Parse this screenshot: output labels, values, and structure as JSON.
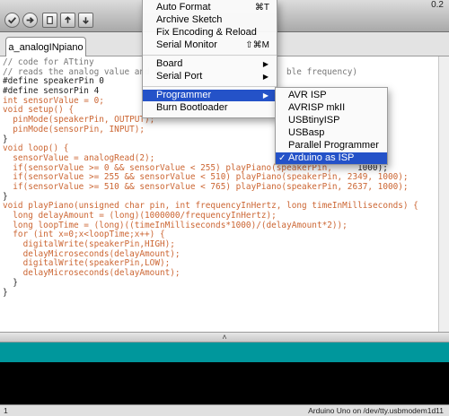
{
  "window": {
    "title_fragment": "0.2"
  },
  "tab": {
    "label": "a_analogINpiano"
  },
  "menu": {
    "items": [
      {
        "label": "Auto Format",
        "shortcut": "⌘T"
      },
      {
        "label": "Archive Sketch"
      },
      {
        "label": "Fix Encoding & Reload"
      },
      {
        "label": "Serial Monitor",
        "shortcut": "⇧⌘M"
      },
      {
        "label": "Board"
      },
      {
        "label": "Serial Port"
      },
      {
        "label": "Programmer"
      },
      {
        "label": "Burn Bootloader"
      }
    ]
  },
  "submenu": {
    "items": [
      {
        "label": "AVR ISP"
      },
      {
        "label": "AVRISP mkII"
      },
      {
        "label": "USBtinyISP"
      },
      {
        "label": "USBasp"
      },
      {
        "label": "Parallel Programmer"
      },
      {
        "label": "Arduino as ISP",
        "checked": "✓"
      }
    ]
  },
  "code": {
    "lines": [
      "// code for ATtiny",
      "// reads the analog value and m",
      "#define speakerPin 0",
      "#define sensorPin 4",
      "int sensorValue = 0;",
      "void setup() {",
      "  pinMode(speakerPin, OUTPUT);",
      "  pinMode(sensorPin, INPUT);",
      "}",
      "void loop() {",
      "  sensorValue = analogRead(2);",
      "  if(sensorValue >= 0 && sensorValue < 255) playPiano(speakerPin,",
      "  if(sensorValue >= 255 && sensorValue < 510) playPiano(speakerPin, 2349, 1000);",
      "  if(sensorValue >= 510 && sensorValue < 765) playPiano(speakerPin, 2637, 1000);",
      "}",
      "void playPiano(unsigned char pin, int frequencyInHertz, long timeInMilliseconds) {",
      "  long delayAmount = (long)(1000000/frequencyInHertz);",
      "  long loopTime = (long)((timeInMilliseconds*1000)/(delayAmount*2));",
      "  for (int x=0;x<loopTime;x++) {",
      "    digitalWrite(speakerPin,HIGH);",
      "    delayMicroseconds(delayAmount);",
      "    digitalWrite(speakerPin,LOW);",
      "    delayMicroseconds(delayAmount);",
      "  }",
      "}"
    ],
    "line1_tail": "ble frequency)",
    "line11_tail": "1000);"
  },
  "footer": {
    "line_number": "1",
    "board": "Arduino Uno on /dev/tty.usbmodem1d11"
  },
  "colors": {
    "accent": "#2452c8",
    "status_bar": "#00979c",
    "console": "#000000"
  },
  "icons": [
    "verify-icon",
    "upload-icon",
    "new-icon",
    "open-icon",
    "save-icon"
  ]
}
